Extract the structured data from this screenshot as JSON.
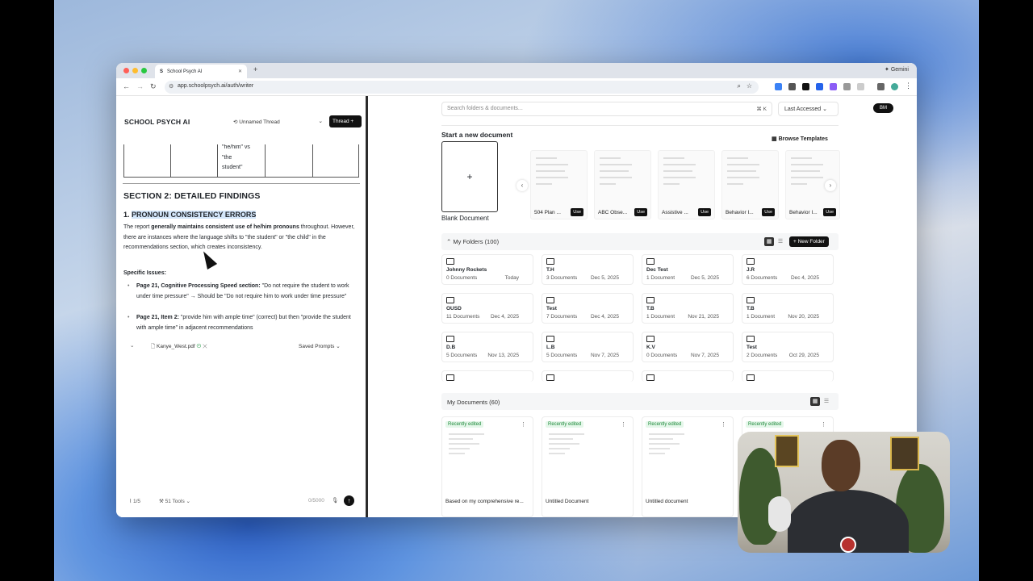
{
  "browser": {
    "tab_title": "School Psych AI",
    "tab_icon": "S",
    "new_tab": "+",
    "gemini_label": "Gemini",
    "url": "app.schoolpsych.ai/auth/writer"
  },
  "left": {
    "logo": "SCHOOL PSYCH AI",
    "thread_select": "Unnamed Thread",
    "thread_button": "Thread +",
    "table_cell_lines": [
      "\"he/him\" vs",
      "\"the",
      "student\""
    ],
    "section_title": "SECTION 2: DETAILED FINDINGS",
    "subheading_num": "1. ",
    "subheading_text": "PRONOUN CONSISTENCY ERRORS",
    "para_1": "The report ",
    "para_bold": "generally maintains consistent use of he/him pronouns",
    "para_2": " throughout. However, there are instances where the language shifts to \"the student\" or \"the child\" in the recommendations section, which creates inconsistency.",
    "specific_issues": "Specific Issues:",
    "bullets": [
      {
        "bold": "Page 21, Cognitive Processing Speed section:",
        "text": " \"Do not require the student to work under time pressure\" → Should be \"Do not require him to work under time pressure\""
      },
      {
        "bold": "Page 21, Item 2:",
        "text": " \"provide him with ample time\" (correct) but then \"provide the student with ample time\" in adjacent recommendations"
      }
    ],
    "attachment": "Kanye_West.pdf",
    "saved_prompts": "Saved Prompts",
    "attach_count": "1/5",
    "tools": "51 Tools",
    "char_count": "0/5000"
  },
  "right": {
    "search_placeholder": "Search folders & documents...",
    "search_shortcut": "⌘ K",
    "sort": "Last Accessed",
    "avatar": "BM",
    "start_new": "Start a new document",
    "browse_templates": "Browse Templates",
    "blank_plus": "+",
    "blank_label": "Blank Document",
    "templates": [
      {
        "name": "504 Plan ...",
        "use": "Use"
      },
      {
        "name": "ABC Obse...",
        "use": "Use"
      },
      {
        "name": "Assistive ...",
        "use": "Use"
      },
      {
        "name": "Behavior I...",
        "use": "Use"
      },
      {
        "name": "Behavior I...",
        "use": "Use"
      }
    ],
    "folders_title": "My Folders (100)",
    "new_folder": "+ New Folder",
    "folders": [
      {
        "name": "Johnny Rockets",
        "count": "0 Documents",
        "date": "Today"
      },
      {
        "name": "T.H",
        "count": "3 Documents",
        "date": "Dec 5, 2025"
      },
      {
        "name": "Dec Test",
        "count": "1 Document",
        "date": "Dec 5, 2025"
      },
      {
        "name": "J.R",
        "count": "6 Documents",
        "date": "Dec 4, 2025"
      },
      {
        "name": "OUSD",
        "count": "11 Documents",
        "date": "Dec 4, 2025"
      },
      {
        "name": "Test",
        "count": "7 Documents",
        "date": "Dec 4, 2025"
      },
      {
        "name": "T.B",
        "count": "1 Document",
        "date": "Nov 21, 2025"
      },
      {
        "name": "T.B",
        "count": "1 Document",
        "date": "Nov 20, 2025"
      },
      {
        "name": "D.B",
        "count": "5 Documents",
        "date": "Nov 13, 2025"
      },
      {
        "name": "L.B",
        "count": "5 Documents",
        "date": "Nov 7, 2025"
      },
      {
        "name": "K.V",
        "count": "0 Documents",
        "date": "Nov 7, 2025"
      },
      {
        "name": "Test",
        "count": "2 Documents",
        "date": "Oct 29, 2025"
      }
    ],
    "documents_title": "My Documents (60)",
    "documents": [
      {
        "badge": "Recently edited",
        "name": "Based on my comprehensive re..."
      },
      {
        "badge": "Recently edited",
        "name": "Untitled Document"
      },
      {
        "badge": "Recently edited",
        "name": "Untitled document"
      },
      {
        "badge": "Recently edited",
        "name": ""
      }
    ]
  }
}
